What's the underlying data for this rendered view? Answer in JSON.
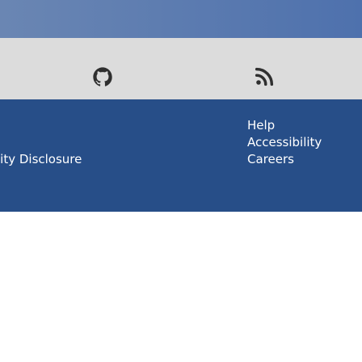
{
  "social": {
    "icons": [
      {
        "name": "github-icon",
        "color": "#2f2f2f"
      },
      {
        "name": "rss-icon",
        "color": "#2f2f2f"
      }
    ]
  },
  "footer": {
    "links": [
      {
        "label": "Help"
      },
      {
        "label": "Accessibility"
      },
      {
        "label": "Careers"
      },
      {
        "label": "lity Disclosure"
      }
    ]
  },
  "colors": {
    "header_blue": "#5677af",
    "icon_strip_gray": "#dcdcdc",
    "footer_blue": "#274e88",
    "footer_text": "#ffffff"
  }
}
